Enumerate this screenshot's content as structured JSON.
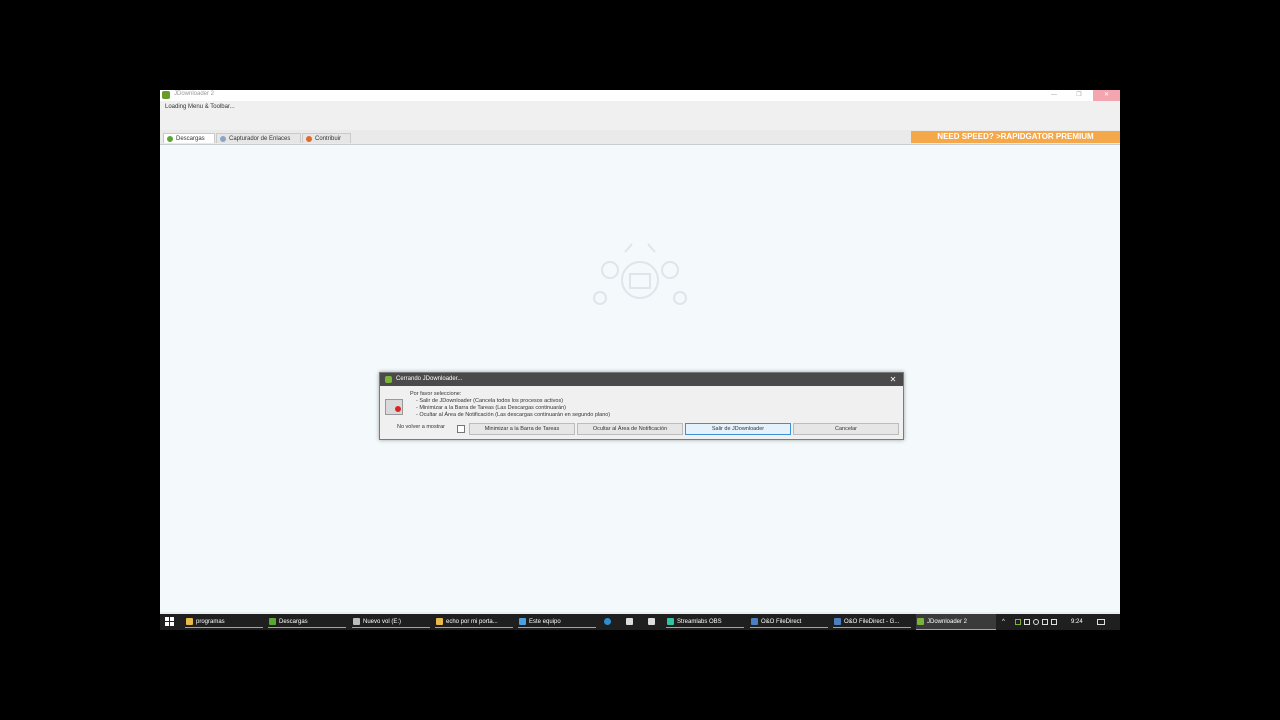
{
  "window": {
    "title": "JDownloader 2",
    "status_text": "Loading Menu & Toolbar..."
  },
  "tabs": [
    {
      "label": "Descargas",
      "icon": "download-icon",
      "active": true
    },
    {
      "label": "Capturador de Enlaces",
      "icon": "link-grabber-icon",
      "active": false
    },
    {
      "label": "Contribuir",
      "icon": "heart-icon",
      "active": false
    }
  ],
  "premium_banner": "NEED SPEED? >RAPIDGATOR PREMIUM",
  "dialog": {
    "title": "Cerrando JDownloader...",
    "message_lines": [
      "Por favor seleccione:",
      "- Salir de JDownloader (Cancela todos los procesos activos)",
      "- Minimizar a la Barra de Tareas (Las Descargas continuarán)",
      "- Ocultar al Área de Notificación (Las descargas continuarán en segundo plano)"
    ],
    "dont_show_label": "No volver a mostrar",
    "buttons": {
      "minimize": "Minimizar a la Barra de Tareas",
      "hide": "Ocultar al Área de Notificación",
      "exit": "Salir de JDownloader",
      "cancel": "Cancelar"
    }
  },
  "taskbar": {
    "items": [
      {
        "label": "programas",
        "icon": "folder-icon"
      },
      {
        "label": "Descargas",
        "icon": "download-icon"
      },
      {
        "label": "Nuevo vol (E:)",
        "icon": "drive-icon"
      },
      {
        "label": "echo por mi porta...",
        "icon": "folder-icon"
      },
      {
        "label": "Este equipo",
        "icon": "computer-icon"
      },
      {
        "label": "Streamlabs OBS",
        "icon": "streamlabs-icon"
      },
      {
        "label": "O&O FileDirect",
        "icon": "filedirect-icon"
      },
      {
        "label": "O&O FileDirect - G...",
        "icon": "filedirect-icon"
      },
      {
        "label": "JDownloader 2",
        "icon": "jdownloader-icon"
      }
    ],
    "clock": "9:24"
  },
  "colors": {
    "accent": "#3d8fd6",
    "premium": "#f5a84a",
    "taskbar": "#1f1f1f",
    "dialog_title": "#4a4a4a"
  }
}
